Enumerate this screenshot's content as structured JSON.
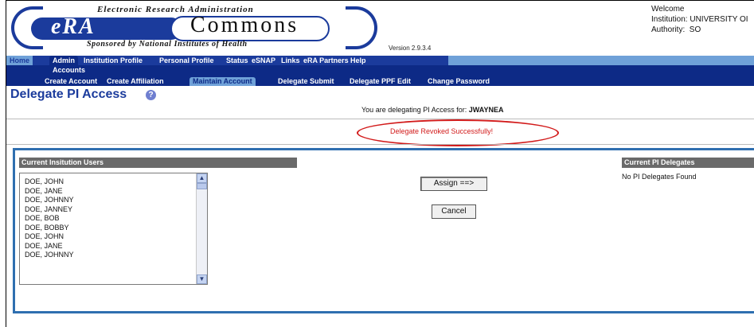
{
  "header": {
    "tagline_top": "Electronic Research Administration",
    "era": "eRA",
    "commons": "Commons",
    "tagline_bottom": "Sponsored by National Institutes of Health",
    "version": "Version 2.9.3.4",
    "welcome": "Welcome",
    "institution": "Institution: UNIVERSITY OI",
    "authority": "Authority:  SO"
  },
  "nav": {
    "items": [
      "Home",
      "Admin",
      "Institution Profile",
      "Personal Profile",
      "Status",
      "eSNAP",
      "Links",
      "eRA Partners",
      "Help"
    ],
    "active": "Admin",
    "section": "Accounts",
    "sub_items": [
      "Create Account",
      "Create Affiliation",
      "Maintain Account",
      "Delegate Submit",
      "Delegate PPF Edit",
      "Change Password"
    ],
    "sub_active": "Maintain Account"
  },
  "page": {
    "title": "Delegate PI Access",
    "delegating_prefix": "You are delegating PI Access for:",
    "delegating_user": "JWAYNEA",
    "success_message": "Delegate Revoked Successfully!"
  },
  "users": {
    "header": "Current Insitution Users",
    "list": [
      "DOE, JOHN",
      "DOE, JANE",
      "DOE, JOHNNY",
      "DOE, JANNEY",
      "DOE, BOB",
      "DOE, BOBBY",
      "DOE, JOHN",
      "DOE, JANE",
      "DOE, JOHNNY"
    ]
  },
  "actions": {
    "assign": "Assign ==>",
    "cancel": "Cancel"
  },
  "delegates": {
    "header": "Current PI Delegates",
    "empty": "No PI Delegates Found"
  },
  "icons": {
    "help": "help-icon",
    "scroll_up": "chevron-up-icon",
    "scroll_down": "chevron-down-icon"
  },
  "colors": {
    "brand_blue": "#1b3b9c",
    "nav_dark": "#0d2a86",
    "nav_light": "#6fa1d8",
    "success_red": "#d21a1a",
    "panel_border": "#2f6fb0"
  }
}
